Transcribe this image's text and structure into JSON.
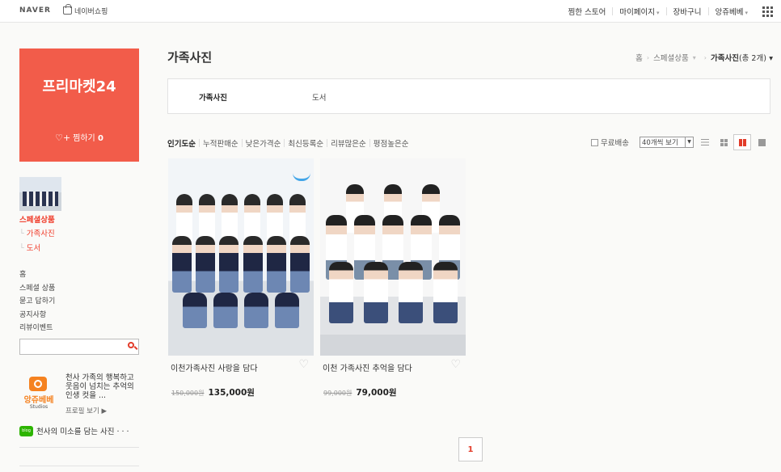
{
  "header": {
    "logo": "NAVER",
    "shopping": "네이버쇼핑",
    "nav": [
      {
        "label": "찜한 스토어",
        "caret": false
      },
      {
        "label": "마이페이지",
        "caret": true
      },
      {
        "label": "장바구니",
        "caret": false
      },
      {
        "label": "앙쥬베베",
        "caret": true
      }
    ]
  },
  "store": {
    "name": "프리마켓24",
    "favorite_label": "찜하기",
    "favorite_count": "0"
  },
  "sidebar": {
    "category_main": "스페셜상품",
    "category_subs": [
      "가족사진",
      "도서"
    ],
    "links": [
      "홈",
      "스페셜 상품",
      "묻고 답하기",
      "공지사항",
      "리뷰이벤트"
    ],
    "search_placeholder": "",
    "profile": {
      "logo_text": "앙쥬베베",
      "logo_sub": "Studios",
      "description": "천사 가족의 행복하고 웃음이 넘치는 추억의 인생 컷을 ...",
      "profile_link": "프로필 보기 ▶"
    },
    "blog": {
      "badge": "blog",
      "title": "천사의 미소를 담는 사진 · · ·"
    }
  },
  "main": {
    "title": "가족사진",
    "breadcrumb": {
      "home": "홈",
      "parent": "스페셜상품",
      "current": "가족사진",
      "count": "(총 2개)"
    },
    "tabs": [
      "가족사진",
      "도서"
    ],
    "sort": [
      "인기도순",
      "누적판매순",
      "낮은가격순",
      "최신등록순",
      "리뷰많은순",
      "평점높은순"
    ],
    "sort_active": "인기도순",
    "free_shipping": "무료배송",
    "per_page": "40개씩 보기",
    "views": [
      "list-view-icon",
      "grid-small-view-icon",
      "grid-large-view-icon",
      "single-view-icon"
    ]
  },
  "products": [
    {
      "title": "이천가족사진 사랑을 담다",
      "old_price": "150,000원",
      "price": "135,000원"
    },
    {
      "title": "이천 가족사진 추억을 담다",
      "old_price": "99,000원",
      "price": "79,000원"
    }
  ],
  "pagination": {
    "current": "1"
  },
  "colors": {
    "accent": "#f25c4a",
    "brand_red": "#e23c2a",
    "blog_green": "#2db400"
  }
}
